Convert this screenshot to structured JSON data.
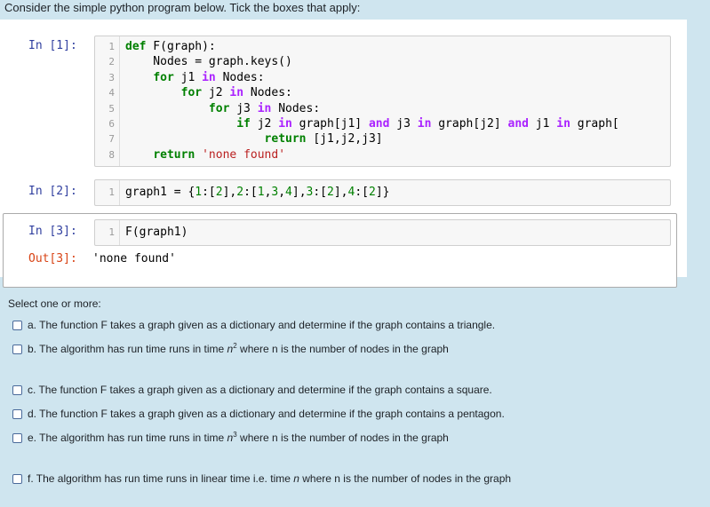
{
  "question": "Consider the simple python program below. Tick the boxes that apply:",
  "cells": [
    {
      "prompt": "In [1]:",
      "lines": [
        {
          "num": "1",
          "tokens": [
            {
              "t": "kw",
              "v": "def"
            },
            {
              "t": "plain",
              "v": " F(graph):"
            }
          ]
        },
        {
          "num": "2",
          "tokens": [
            {
              "t": "plain",
              "v": "    Nodes = graph.keys()"
            }
          ]
        },
        {
          "num": "3",
          "tokens": [
            {
              "t": "plain",
              "v": "    "
            },
            {
              "t": "kw",
              "v": "for"
            },
            {
              "t": "plain",
              "v": " j1 "
            },
            {
              "t": "op",
              "v": "in"
            },
            {
              "t": "plain",
              "v": " Nodes:"
            }
          ]
        },
        {
          "num": "4",
          "tokens": [
            {
              "t": "plain",
              "v": "        "
            },
            {
              "t": "kw",
              "v": "for"
            },
            {
              "t": "plain",
              "v": " j2 "
            },
            {
              "t": "op",
              "v": "in"
            },
            {
              "t": "plain",
              "v": " Nodes:"
            }
          ]
        },
        {
          "num": "5",
          "tokens": [
            {
              "t": "plain",
              "v": "            "
            },
            {
              "t": "kw",
              "v": "for"
            },
            {
              "t": "plain",
              "v": " j3 "
            },
            {
              "t": "op",
              "v": "in"
            },
            {
              "t": "plain",
              "v": " Nodes:"
            }
          ]
        },
        {
          "num": "6",
          "tokens": [
            {
              "t": "plain",
              "v": "                "
            },
            {
              "t": "kw",
              "v": "if"
            },
            {
              "t": "plain",
              "v": " j2 "
            },
            {
              "t": "op",
              "v": "in"
            },
            {
              "t": "plain",
              "v": " graph[j1] "
            },
            {
              "t": "op",
              "v": "and"
            },
            {
              "t": "plain",
              "v": " j3 "
            },
            {
              "t": "op",
              "v": "in"
            },
            {
              "t": "plain",
              "v": " graph[j2] "
            },
            {
              "t": "op",
              "v": "and"
            },
            {
              "t": "plain",
              "v": " j1 "
            },
            {
              "t": "op",
              "v": "in"
            },
            {
              "t": "plain",
              "v": " graph["
            }
          ]
        },
        {
          "num": "7",
          "tokens": [
            {
              "t": "plain",
              "v": "                    "
            },
            {
              "t": "kw",
              "v": "return"
            },
            {
              "t": "plain",
              "v": " [j1,j2,j3]"
            }
          ]
        },
        {
          "num": "8",
          "tokens": [
            {
              "t": "plain",
              "v": "    "
            },
            {
              "t": "kw",
              "v": "return"
            },
            {
              "t": "plain",
              "v": " "
            },
            {
              "t": "str",
              "v": "'none found'"
            }
          ]
        }
      ]
    },
    {
      "prompt": "In [2]:",
      "lines": [
        {
          "num": "1",
          "tokens": [
            {
              "t": "plain",
              "v": "graph1 = {"
            },
            {
              "t": "num",
              "v": "1"
            },
            {
              "t": "plain",
              "v": ":["
            },
            {
              "t": "num",
              "v": "2"
            },
            {
              "t": "plain",
              "v": "],"
            },
            {
              "t": "num",
              "v": "2"
            },
            {
              "t": "plain",
              "v": ":["
            },
            {
              "t": "num",
              "v": "1"
            },
            {
              "t": "plain",
              "v": ","
            },
            {
              "t": "num",
              "v": "3"
            },
            {
              "t": "plain",
              "v": ","
            },
            {
              "t": "num",
              "v": "4"
            },
            {
              "t": "plain",
              "v": "],"
            },
            {
              "t": "num",
              "v": "3"
            },
            {
              "t": "plain",
              "v": ":["
            },
            {
              "t": "num",
              "v": "2"
            },
            {
              "t": "plain",
              "v": "],"
            },
            {
              "t": "num",
              "v": "4"
            },
            {
              "t": "plain",
              "v": ":["
            },
            {
              "t": "num",
              "v": "2"
            },
            {
              "t": "plain",
              "v": "]}"
            }
          ]
        }
      ]
    },
    {
      "prompt": "In [3]:",
      "lines": [
        {
          "num": "1",
          "tokens": [
            {
              "t": "plain",
              "v": "F(graph1)"
            }
          ]
        }
      ],
      "out_prompt": "Out[3]:",
      "output": "'none found'"
    }
  ],
  "select_label": "Select one or more:",
  "options": [
    {
      "pre": "a. The function F takes a graph given as a dictionary and determine if the graph contains a triangle.",
      "post": "",
      "sup": "",
      "italic": "",
      "checked": false
    },
    {
      "pre": "b. The algorithm has run time runs in time ",
      "italic": "n",
      "sup": "2",
      "post": " where n is the number of nodes in the graph",
      "checked": false
    },
    {
      "pre": "c. The function F takes a graph given as a dictionary and determine if the graph contains a square.",
      "italic": "",
      "sup": "",
      "post": "",
      "checked": false
    },
    {
      "pre": "d. The function F takes a graph given as a dictionary and determine if the graph contains a pentagon.",
      "italic": "",
      "sup": "",
      "post": "",
      "checked": false
    },
    {
      "pre": "e. The algorithm has run time runs in time ",
      "italic": "n",
      "sup": "3",
      "post": " where n is the number of nodes in the graph",
      "checked": false
    },
    {
      "pre": "f. The algorithm has run time runs in linear time i.e. time ",
      "italic": "n",
      "sup": "",
      "post": " where n is the number of nodes in the graph",
      "checked": false
    }
  ],
  "colors": {
    "page_bg": "#cfe5ef",
    "keyword": "#008000",
    "operator": "#aa22ff",
    "string": "#ba2121",
    "in_prompt": "#303f9f",
    "out_prompt": "#d84315"
  }
}
